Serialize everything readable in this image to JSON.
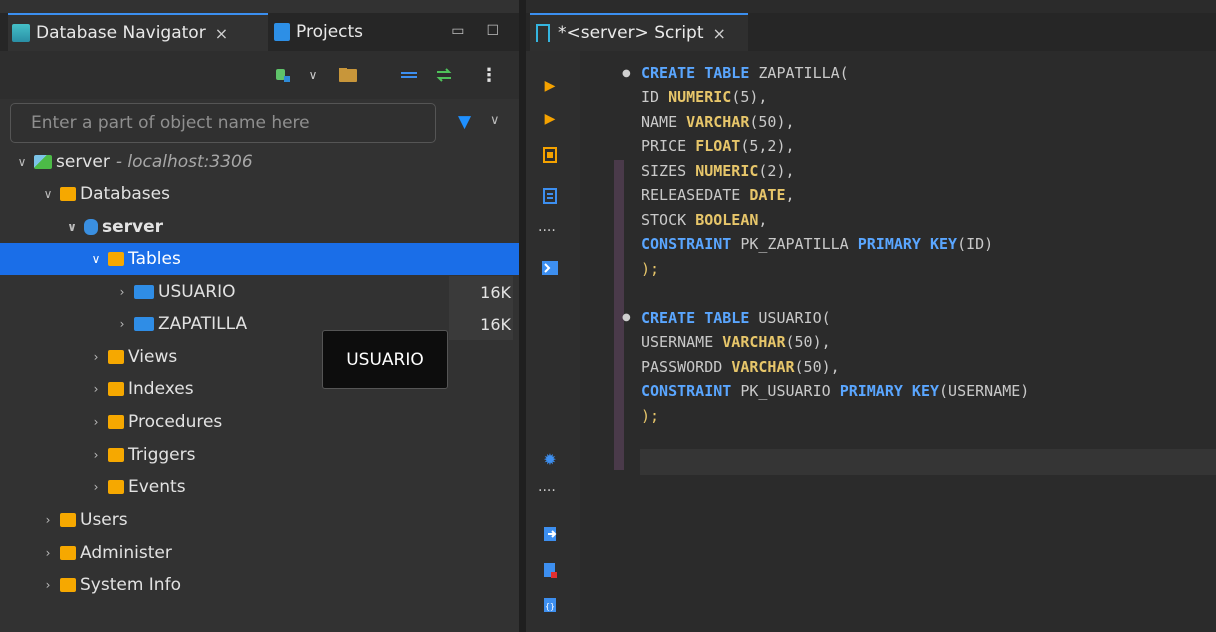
{
  "left_panel": {
    "tabs": [
      {
        "label": "Database Navigator",
        "close": "×"
      },
      {
        "label": "Projects"
      }
    ],
    "window_buttons": {
      "minimize": "▭",
      "maximize": "☐"
    },
    "filter": {
      "placeholder": "Enter a part of object name here"
    },
    "tree": [
      {
        "label": "server",
        "suffix": "- localhost:3306",
        "expanded": true
      },
      {
        "label": "Databases",
        "expanded": true
      },
      {
        "label": "server",
        "expanded": true
      },
      {
        "label": "Tables",
        "expanded": true,
        "selected": true
      },
      {
        "label": "USUARIO",
        "size": "16K"
      },
      {
        "label": "ZAPATILLA",
        "size": "16K"
      },
      {
        "label": "Views"
      },
      {
        "label": "Indexes"
      },
      {
        "label": "Procedures"
      },
      {
        "label": "Triggers"
      },
      {
        "label": "Events"
      },
      {
        "label": "Users"
      },
      {
        "label": "Administer"
      },
      {
        "label": "System Info"
      }
    ],
    "tooltip": "USUARIO"
  },
  "editor": {
    "tab": {
      "label": "*<server> Script",
      "close": "×"
    },
    "code_lines": [
      "CREATE TABLE ZAPATILLA(",
      "ID NUMERIC(5),",
      "NAME VARCHAR(50),",
      "PRICE FLOAT(5,2),",
      "SIZES NUMERIC(2),",
      "RELEASEDATE DATE,",
      "STOCK BOOLEAN,",
      "CONSTRAINT PK_ZAPATILLA PRIMARY KEY(ID)",
      ");",
      "",
      "CREATE TABLE USUARIO(",
      "USERNAME VARCHAR(50),",
      "PASSWORDD VARCHAR(50),",
      "CONSTRAINT PK_USUARIO PRIMARY KEY(USERNAME)",
      ");"
    ]
  },
  "colors": {
    "accent": "#1a6ee8",
    "keyword_blue": "#5aa6ff",
    "keyword_yellow": "#e7c66a",
    "folder": "#f6a800"
  }
}
